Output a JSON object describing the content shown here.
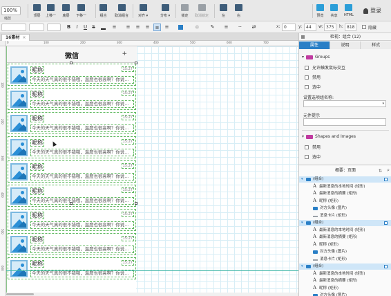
{
  "toolbar": {
    "zoom": "100%",
    "zoom_label": "缩放",
    "buttons": [
      {
        "label": "顶层",
        "icon": "bring-to-front-icon"
      },
      {
        "label": "上移一",
        "icon": "bring-forward-icon"
      },
      {
        "label": "底层",
        "icon": "send-to-back-icon"
      },
      {
        "label": "下移一",
        "icon": "send-backward-icon"
      },
      {
        "label": "组合",
        "icon": "group-icon"
      },
      {
        "label": "取消组合",
        "icon": "ungroup-icon"
      },
      {
        "label": "对齐 ▾",
        "icon": "align-icon"
      },
      {
        "label": "分布 ▾",
        "icon": "distribute-icon"
      },
      {
        "label": "锁定",
        "icon": "lock-icon"
      },
      {
        "label": "取消锁定",
        "icon": "unlock-icon"
      },
      {
        "label": "左",
        "icon": "left-icon"
      },
      {
        "label": "右",
        "icon": "right-icon"
      },
      {
        "label": "预览",
        "icon": "preview-icon"
      },
      {
        "label": "共享",
        "icon": "share-icon"
      },
      {
        "label": "HTML",
        "icon": "html-icon"
      }
    ],
    "login": "登录"
  },
  "formatbar": {
    "bold": "B",
    "italic": "I",
    "underline": "U",
    "strike": "S",
    "x_label": "x:",
    "x": "0",
    "y_label": "y:",
    "y": "44",
    "w_label": "w:",
    "w": "375",
    "h_label": "h:",
    "h": "818",
    "hidden": "隐藏"
  },
  "page_tab": {
    "label": "16素材",
    "close": "×"
  },
  "ruler": {
    "top": [
      "0",
      "100",
      "200",
      "300",
      "400",
      "500",
      "600",
      "700",
      "800"
    ],
    "left": [
      "100",
      "200",
      "300",
      "400",
      "500",
      "600",
      "700"
    ]
  },
  "phone": {
    "title": "微信",
    "plus": "+",
    "rows": [
      {
        "nick": "昵称",
        "time": "15:27",
        "msg": "今天的天气真的很不错哦，温度也很高啊？你说..."
      },
      {
        "nick": "昵称",
        "time": "15:27",
        "msg": "今天的天气真的很不错哦，温度也很高啊？你说..."
      },
      {
        "nick": "昵称",
        "time": "15:27",
        "msg": "今天的天气真的很不错哦，温度也很高啊？你说..."
      },
      {
        "nick": "昵称",
        "time": "15:27",
        "msg": "今天的天气真的很不错哦，温度也很高啊？你说..."
      },
      {
        "nick": "昵称",
        "time": "15:27",
        "msg": "今天的天气真的很不错哦，温度也很高啊？你说..."
      },
      {
        "nick": "昵称",
        "time": "15:27",
        "msg": "今天的天气真的很不错哦，温度也很高啊？你说..."
      },
      {
        "nick": "昵称",
        "time": "15:27",
        "msg": "今天的天气真的很不错哦，温度也很高啊？你说..."
      },
      {
        "nick": "昵称",
        "time": "15:27",
        "msg": "今天的天气真的很不错哦，温度也很高啊？你说..."
      },
      {
        "nick": "昵称",
        "time": "15:27",
        "msg": "今天的天气真的很不错哦，温度也很高啊？你说..."
      }
    ]
  },
  "inspector": {
    "title": "检视：组合 (12)",
    "tabs": [
      "属性",
      "说明",
      "样式"
    ],
    "groups_section": "Groups",
    "groups_checks": [
      "允许触发鼠标交互",
      "禁用",
      "选中"
    ],
    "option_group_label": "设置选项组名称:",
    "tooltip_label": "元件提示",
    "shapes_section": "Shapes and Images",
    "shapes_checks": [
      "禁用",
      "选中"
    ]
  },
  "outline": {
    "title": "概要：页面",
    "filter_icon": "⇅",
    "search_icon": "⌕",
    "items": [
      {
        "type": "group",
        "label": "(组合)"
      },
      {
        "type": "text",
        "label": "最新消息的本地时间 (矩形)"
      },
      {
        "type": "text",
        "label": "最新消息的摘要 (矩形)"
      },
      {
        "type": "text",
        "label": "昵称 (矩形)"
      },
      {
        "type": "folder",
        "label": "对方头像 (图片)"
      },
      {
        "type": "line",
        "label": "消息卡片 (矩形)"
      },
      {
        "type": "group",
        "label": "(组合)"
      },
      {
        "type": "text",
        "label": "最新消息的本地时间 (矩形)"
      },
      {
        "type": "text",
        "label": "最新消息的摘要 (矩形)"
      },
      {
        "type": "text",
        "label": "昵称 (矩形)"
      },
      {
        "type": "folder",
        "label": "对方头像 (图片)"
      },
      {
        "type": "line",
        "label": "消息卡片 (矩形)"
      },
      {
        "type": "group",
        "label": "(组合)"
      },
      {
        "type": "text",
        "label": "最新消息的本地时间 (矩形)"
      },
      {
        "type": "text",
        "label": "最新消息的摘要 (矩形)"
      },
      {
        "type": "text",
        "label": "昵称 (矩形)"
      },
      {
        "type": "folder",
        "label": "对方头像 (图片)"
      }
    ]
  },
  "colors": {
    "accent": "#2a7fc6",
    "selection": "#5fb85f",
    "guide": "#3fb6a8",
    "icon_blue": "#2b8fd6"
  }
}
